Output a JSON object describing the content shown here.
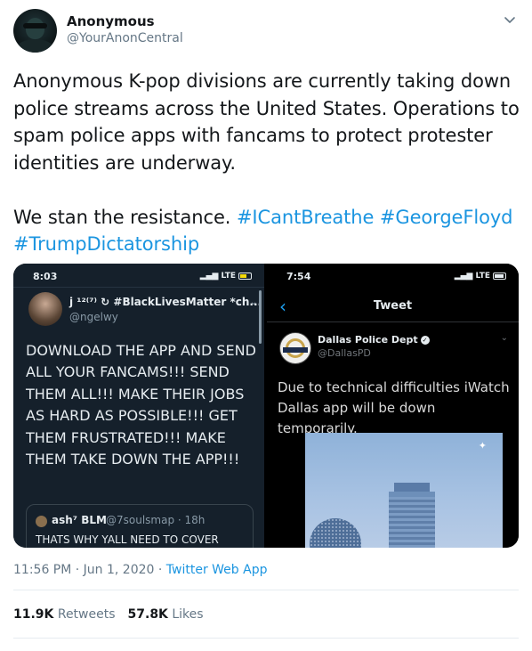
{
  "author": {
    "name": "Anonymous",
    "handle": "@YourAnonCentral"
  },
  "tweet": {
    "paragraph1": "Anonymous K-pop divisions are currently taking down police streams across the United States. Operations to spam police apps with fancams to protect protester identities are underway.",
    "paragraph2_text": "We stan the resistance. ",
    "hashtags": [
      "#ICantBreathe",
      "#GeorgeFloyd",
      "#TrumpDictatorship"
    ]
  },
  "media": {
    "left_screenshot": {
      "time": "8:03",
      "signal": "LTE",
      "user_name": "j ¹²⁽⁷⁾ ↻ #BlackLivesMatter *ch...",
      "user_handle": "@ngelwy",
      "body": "DOWNLOAD THE APP AND SEND ALL YOUR FANCAMS!!! SEND THEM ALL!!! MAKE THEIR JOBS AS HARD AS POSSIBLE!!! GET THEM FRUSTRATED!!! MAKE THEM TAKE DOWN THE APP!!!",
      "quote_name": "ash⁷ BLM",
      "quote_meta": "@7soulsmap · 18h",
      "quote_text": "THATS WHY YALL NEED TO COVER"
    },
    "right_screenshot": {
      "time": "7:54",
      "signal": "LTE",
      "header_title": "Tweet",
      "user_name": "Dallas Police Dept",
      "user_handle": "@DallasPD",
      "body": "Due to technical difficulties iWatch Dallas app will be down temporarily."
    }
  },
  "meta": {
    "timestamp": "11:56 PM · Jun 1, 2020 · ",
    "source": "Twitter Web App"
  },
  "stats": {
    "retweets_count": "11.9K",
    "retweets_label": " Retweets",
    "likes_count": "57.8K",
    "likes_label": " Likes"
  },
  "colors": {
    "link": "#1b95e0",
    "text": "#14171a",
    "secondary": "#657786"
  }
}
